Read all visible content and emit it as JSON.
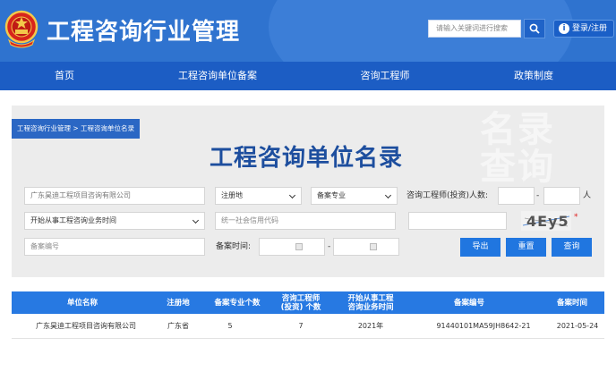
{
  "header": {
    "site_title": "工程咨询行业管理",
    "search_placeholder": "请输入关键词进行搜索",
    "login_label": "登录/注册",
    "brand_color": "#2f73cf"
  },
  "nav": {
    "items": [
      "首页",
      "工程咨询单位备案",
      "咨询工程师",
      "政策制度"
    ]
  },
  "breadcrumb": "工程咨询行业管理 > 工程咨询单位名录",
  "watermark": [
    "名录",
    "查询"
  ],
  "page_title": "工程咨询单位名录",
  "form": {
    "company_name": "广东昊迪工程项目咨询有限公司",
    "region_select": "注册地",
    "specialty_select": "备案专业",
    "engineer_count_label": "咨询工程师(投资)人数:",
    "count_separator": "-",
    "count_unit": "人",
    "start_time_select": "开始从事工程咨询业务时间",
    "credit_code_placeholder": "统一社会信用代码",
    "captcha_text": "4Ey5",
    "captcha_required": "*",
    "record_no_placeholder": "备案编号",
    "record_time_label": "备案时间:",
    "date_separator": "-",
    "buttons": {
      "export": "导出",
      "reset": "重置",
      "query": "查询"
    }
  },
  "table": {
    "headers": [
      "单位名称",
      "注册地",
      "备案专业个数",
      "咨询工程师\n(投资) 个数",
      "开始从事工程\n咨询业务时间",
      "备案编号",
      "备案时间"
    ],
    "rows": [
      [
        "广东昊迪工程项目咨询有限公司",
        "广东省",
        "5",
        "7",
        "2021年",
        "91440101MA59JH8642-21",
        "2021-05-24"
      ]
    ]
  }
}
